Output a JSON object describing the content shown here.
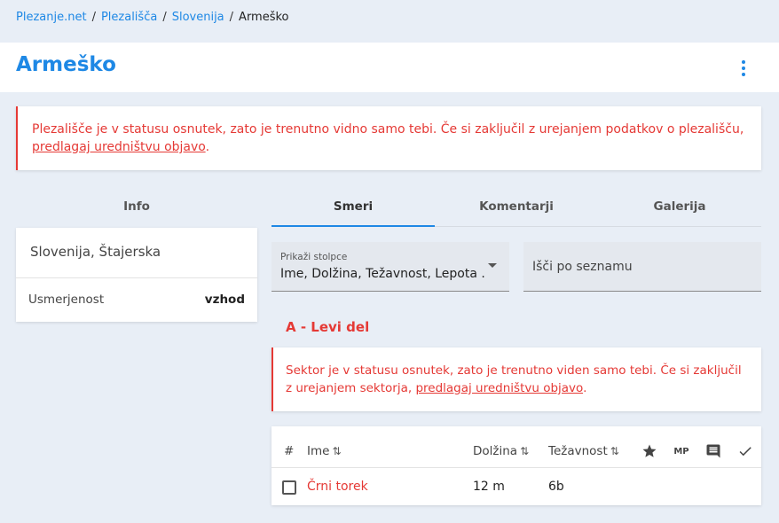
{
  "breadcrumb": {
    "items": [
      "Plezanje.net",
      "Plezališča",
      "Slovenija"
    ],
    "current": "Armeško",
    "separator": "/"
  },
  "page": {
    "title": "Armeško"
  },
  "alert_crag": {
    "text": "Plezališče je v statusu osnutek, zato je trenutno vidno samo tebi. Če si zaključil z urejanjem podatkov o plezališču, ",
    "link": "predlagaj uredništvu objavo",
    "suffix": "."
  },
  "tabs": [
    {
      "label": "Info",
      "active": false
    },
    {
      "label": "Smeri",
      "active": true
    },
    {
      "label": "Komentarji",
      "active": false
    },
    {
      "label": "Galerija",
      "active": false
    }
  ],
  "info": {
    "location": "Slovenija, Štajerska",
    "orientation_label": "Usmerjenost",
    "orientation_value": "vzhod"
  },
  "columns_select": {
    "label": "Prikaži stolpce",
    "value": "Ime, Dolžina, Težavnost, Lepota ..."
  },
  "search": {
    "placeholder": "Išči po seznamu"
  },
  "sector": {
    "title": "A - Levi del",
    "alert_text": "Sektor je v statusu osnutek, zato je trenutno viden samo tebi. Če si zaključil z urejanjem sektorja, ",
    "alert_link": "predlagaj uredništvu objavo",
    "alert_suffix": "."
  },
  "table": {
    "headers": {
      "num": "#",
      "name": "Ime",
      "length": "Dolžina",
      "grade": "Težavnost",
      "mp": "MP"
    },
    "sort_glyph": "⇅",
    "rows": [
      {
        "name": "Črni torek",
        "length": "12 m",
        "grade": "6b"
      }
    ]
  },
  "colors": {
    "accent": "#1e88e5",
    "warning": "#e53935",
    "background": "#e8eef6"
  }
}
